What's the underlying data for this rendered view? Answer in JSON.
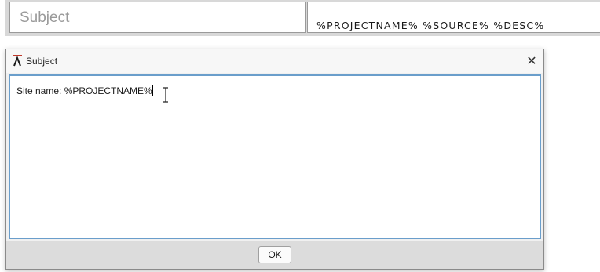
{
  "background_form": {
    "field_label": "Subject",
    "field_value": "%PROJECTNAME% %SOURCE% %DESC%"
  },
  "dialog": {
    "title": "Subject",
    "app_icon": "lambda-icon",
    "close_icon": "close-icon",
    "close_glyph": "✕",
    "editor_text": "Site name: %PROJECTNAME%",
    "ok_label": "OK"
  },
  "colors": {
    "editor_focus_border": "#6a9ecb",
    "footer_bg": "#dcdcdc",
    "dialog_bg": "#f0f0f0"
  }
}
